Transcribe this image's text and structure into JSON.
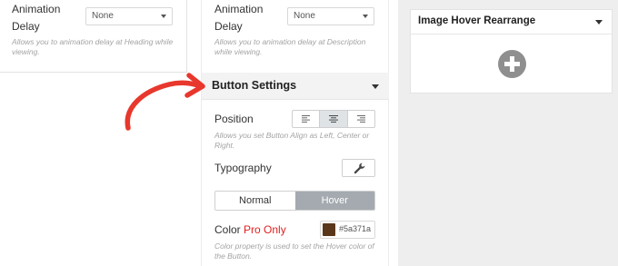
{
  "left_panel": {
    "animation_delay_label_1": "Animation",
    "animation_delay_label_2": "Delay",
    "select_value": "None",
    "help": "Allows you to animation delay at Heading while viewing."
  },
  "mid_panel": {
    "animation_delay_label_1": "Animation",
    "animation_delay_label_2": "Delay",
    "select_value": "None",
    "help": "Allows you to animation delay at Description while viewing.",
    "section_title": "Button Settings",
    "position_label": "Position",
    "position_value": "center",
    "position_help": "Allows you set Button Align as Left, Center or Right.",
    "typography_label": "Typography",
    "tabs": {
      "normal": "Normal",
      "hover": "Hover",
      "active": "hover"
    },
    "color_label": "Color",
    "pro_label": "Pro Only",
    "color_value": "#5a371a",
    "color_help": "Color property is used to set the Hover color of the Button."
  },
  "right_panel": {
    "card_title": "Image Hover Rearrange"
  },
  "icons": {
    "align": [
      "align-left-icon",
      "align-center-icon",
      "align-right-icon"
    ],
    "typography": "wrench-icon",
    "add": "plus-circle-icon",
    "annotation": "curved-arrow-icon"
  },
  "colors": {
    "accent_arrow": "#e8372c",
    "pro": "#e02020",
    "active_tab": "#a4aab0"
  }
}
